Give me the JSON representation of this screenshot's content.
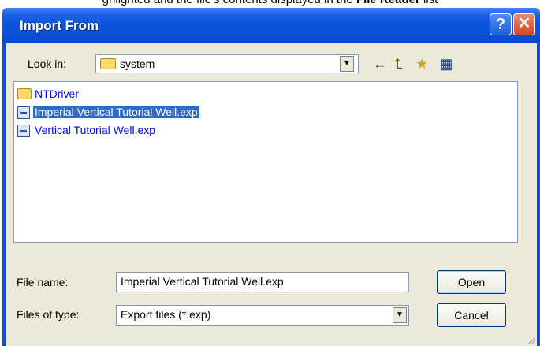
{
  "caption": {
    "pre": "ghlighted and the file's contents displayed in the ",
    "bold": "File Reader",
    "post": " list"
  },
  "window": {
    "title": "Import From",
    "help_glyph": "?",
    "close_glyph": "✕"
  },
  "look_in": {
    "label": "Look in:",
    "value": "system",
    "dropdown_glyph": "▼"
  },
  "toolbar": {
    "back_icon": "←",
    "up_icon": "⮤",
    "new_folder_icon": "★",
    "view_icon": "▦"
  },
  "files": [
    {
      "name": "NTDriver",
      "type": "folder",
      "selected": false
    },
    {
      "name": "Imperial Vertical Tutorial Well.exp",
      "type": "exp-file",
      "selected": true
    },
    {
      "name": "Vertical Tutorial Well.exp",
      "type": "exp-file",
      "selected": false
    }
  ],
  "file_name": {
    "label": "File name:",
    "value": "Imperial Vertical Tutorial Well.exp"
  },
  "files_of_type": {
    "label": "Files of type:",
    "value": "Export files (*.exp)",
    "dropdown_glyph": "▼"
  },
  "buttons": {
    "open": "Open",
    "cancel": "Cancel"
  },
  "colors": {
    "title_bar": "#0a4fd6",
    "selection": "#316ac5",
    "file_link": "#0000ff",
    "dialog_bg": "#ece9d8"
  }
}
